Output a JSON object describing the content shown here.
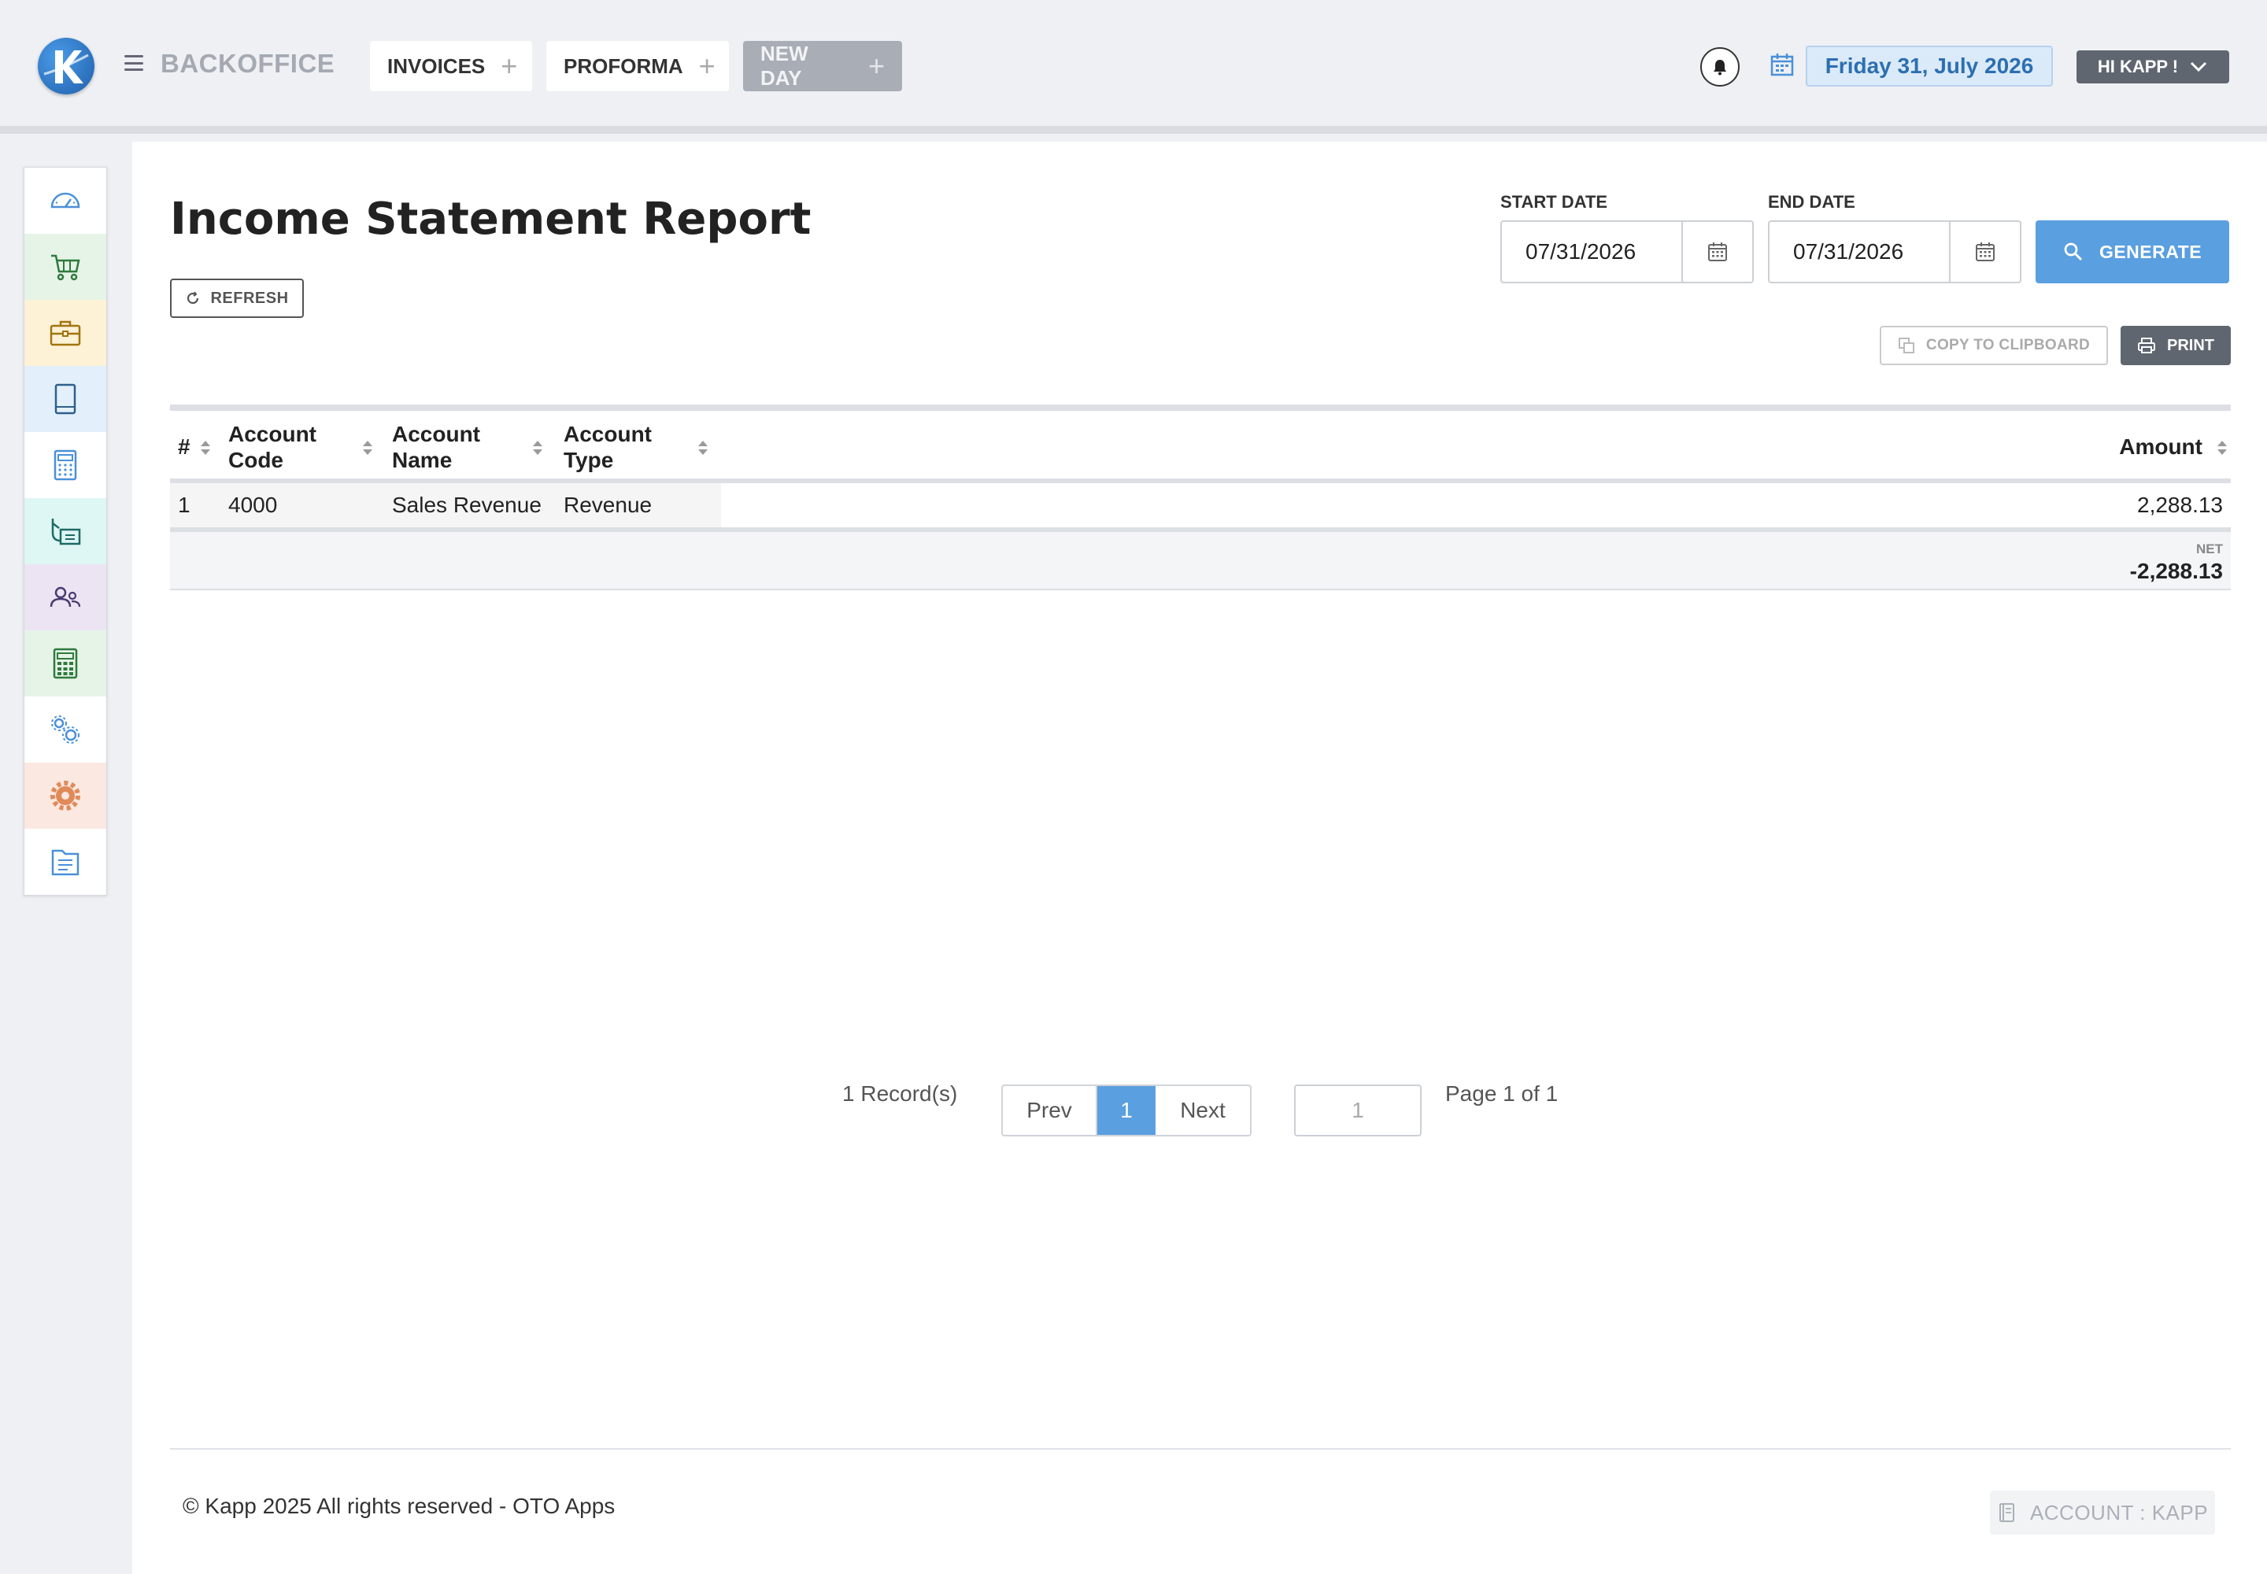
{
  "header": {
    "brand": "BACKOFFICE",
    "tabs": [
      {
        "label": "INVOICES"
      },
      {
        "label": "PROFORMA"
      },
      {
        "label": "NEW DAY"
      }
    ],
    "date": "Friday 31, July 2026",
    "user_greeting": "HI KAPP !"
  },
  "sidebar": {
    "items": [
      {
        "icon": "dashboard-icon",
        "bg": "#ffffff",
        "color": "#4a90d9"
      },
      {
        "icon": "cart-icon",
        "bg": "#e6f4e8",
        "color": "#2f7a3c"
      },
      {
        "icon": "briefcase-icon",
        "bg": "#fdf1d6",
        "color": "#a27410"
      },
      {
        "icon": "book-icon",
        "bg": "#e3f0fb",
        "color": "#2f5f8a"
      },
      {
        "icon": "calculator-icon",
        "bg": "#ffffff",
        "color": "#4a90d9"
      },
      {
        "icon": "cheque-icon",
        "bg": "#def6f4",
        "color": "#1d6b66"
      },
      {
        "icon": "users-icon",
        "bg": "#ece4f3",
        "color": "#4a3b70"
      },
      {
        "icon": "ledger-calculator-icon",
        "bg": "#e6f4e8",
        "color": "#2f7a3c"
      },
      {
        "icon": "gears-icon",
        "bg": "#ffffff",
        "color": "#4a90d9"
      },
      {
        "icon": "settings-icon",
        "bg": "#fbe8e0",
        "color": "#e08a5a"
      },
      {
        "icon": "folder-doc-icon",
        "bg": "#ffffff",
        "color": "#4a90d9"
      }
    ]
  },
  "page": {
    "title": "Income Statement Report",
    "refresh_label": "REFRESH",
    "start_date_label": "START DATE",
    "start_date_value": "07/31/2026",
    "end_date_label": "END DATE",
    "end_date_value": "07/31/2026",
    "generate_label": "GENERATE",
    "copy_label": "COPY TO CLIPBOARD",
    "print_label": "PRINT"
  },
  "table": {
    "columns": {
      "index": "#",
      "account_code": "Account Code",
      "account_name": "Account Name",
      "account_type": "Account Type",
      "amount": "Amount"
    },
    "rows": [
      {
        "index": "1",
        "account_code": "4000",
        "account_name": "Sales Revenue",
        "account_type": "Revenue",
        "amount": "2,288.13"
      }
    ],
    "net_label": "NET",
    "net_value": "-2,288.13"
  },
  "pagination": {
    "records": "1 Record(s)",
    "prev": "Prev",
    "current": "1",
    "next": "Next",
    "goto_placeholder": "1",
    "page_of": "Page 1 of 1"
  },
  "footer": {
    "copyright": "© Kapp 2025 All rights reserved - OTO Apps",
    "account": "ACCOUNT : KAPP"
  },
  "colors": {
    "accent": "#5a9fe0",
    "dark_button": "#5f6670",
    "date_chip_text": "#2c6fb1"
  }
}
